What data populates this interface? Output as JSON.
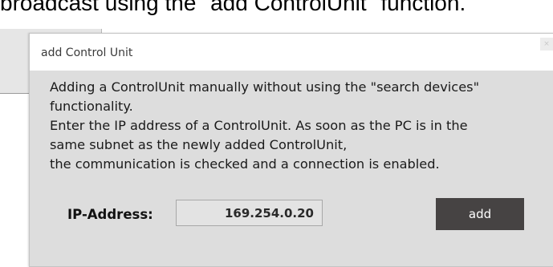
{
  "background": {
    "caption": "broadcast using the \"add ControlUnit\" function."
  },
  "dialog": {
    "title": "add Control Unit",
    "close_glyph": "×",
    "message_lines": [
      "Adding a ControlUnit manually without using the \"search devices\"",
      "functionality.",
      "Enter the IP address of a ControlUnit. As soon as the PC is in the",
      "same subnet as the newly added ControlUnit,",
      "the communication is checked and a connection is enabled."
    ],
    "ip_label": "IP-Address:",
    "ip_value": "169.254.0.20",
    "add_label": "add"
  },
  "colors": {
    "dialog_bg": "#dddddd",
    "title_bar_bg": "#ffffff",
    "add_button_bg": "#464343",
    "input_bg": "#e3e3e3"
  }
}
